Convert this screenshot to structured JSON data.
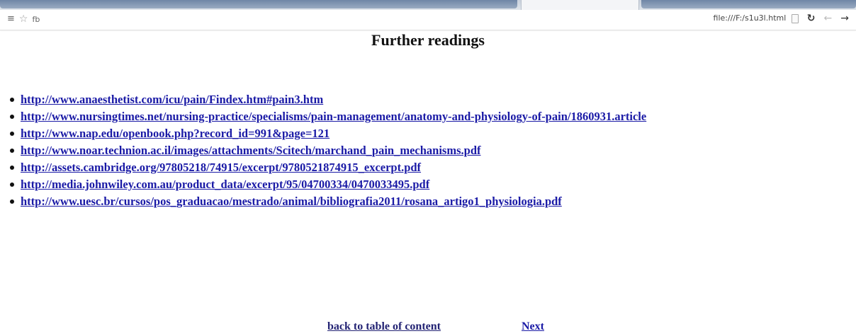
{
  "browser": {
    "tab_label": "fb",
    "url": "file:///F:/s1u3l.html"
  },
  "page": {
    "title": "Further readings",
    "links": [
      "http://www.anaesthetist.com/icu/pain/Findex.htm#pain3.htm",
      "http://www.nursingtimes.net/nursing-practice/specialisms/pain-management/anatomy-and-physiology-of-pain/1860931.article",
      "http://www.nap.edu/openbook.php?record_id=991&page=121",
      "http://www.noar.technion.ac.il/images/attachments/Scitech/marchand_pain_mechanisms.pdf",
      "http://assets.cambridge.org/97805218/74915/excerpt/9780521874915_excerpt.pdf",
      "http://media.johnwiley.com.au/product_data/excerpt/95/04700334/0470033495.pdf",
      "http://www.uesc.br/cursos/pos_graduacao/mestrado/animal/bibliografia2011/rosana_artigo1_physiologia.pdf"
    ],
    "back_label": "back to table of content",
    "next_label": "Next"
  },
  "colors": {
    "link": "#1a1aa6",
    "visited_link": "#232374"
  }
}
